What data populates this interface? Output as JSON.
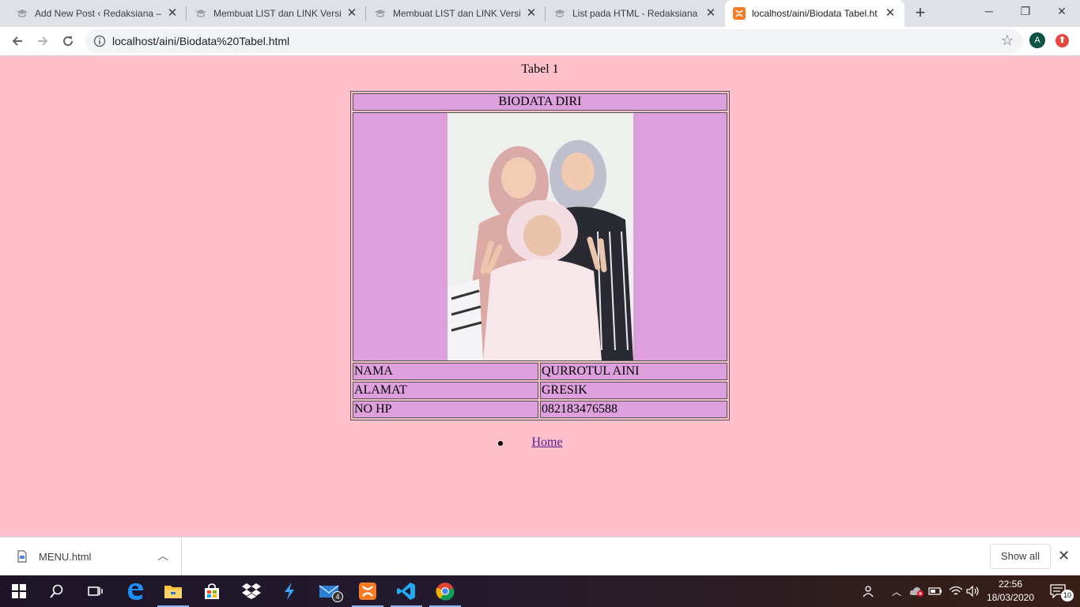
{
  "browser": {
    "tabs": [
      {
        "title": "Add New Post ‹ Redaksiana —",
        "icon": "generic-page-icon",
        "active": false
      },
      {
        "title": "Membuat LIST dan LINK Versi",
        "icon": "generic-page-icon",
        "active": false
      },
      {
        "title": "Membuat LIST dan LINK Versi",
        "icon": "generic-page-icon",
        "active": false
      },
      {
        "title": "List pada HTML - Redaksiana",
        "icon": "generic-page-icon",
        "active": false
      },
      {
        "title": "localhost/aini/Biodata Tabel.ht",
        "icon": "xampp-icon",
        "active": true
      }
    ],
    "new_tab_label": "+",
    "address": "localhost/aini/Biodata%20Tabel.html",
    "profile_initial": "A"
  },
  "page": {
    "caption": "Tabel 1",
    "table": {
      "header": "BIODATA DIRI",
      "rows": [
        {
          "label": "NAMA",
          "value": "QURROTUL AINI"
        },
        {
          "label": "ALAMAT",
          "value": "GRESIK"
        },
        {
          "label": "NO HP",
          "value": "082183476588"
        }
      ]
    },
    "links": [
      {
        "label": "Home"
      }
    ]
  },
  "downloads": {
    "file_name": "MENU.html",
    "show_all_label": "Show all"
  },
  "taskbar": {
    "mail_badge": "4",
    "notification_badge": "10",
    "time": "22:56",
    "date": "18/03/2020"
  },
  "colors": {
    "page_background": "#ffc0cb",
    "table_cell_background": "#dda0dd",
    "link_visited": "#551a8b"
  }
}
